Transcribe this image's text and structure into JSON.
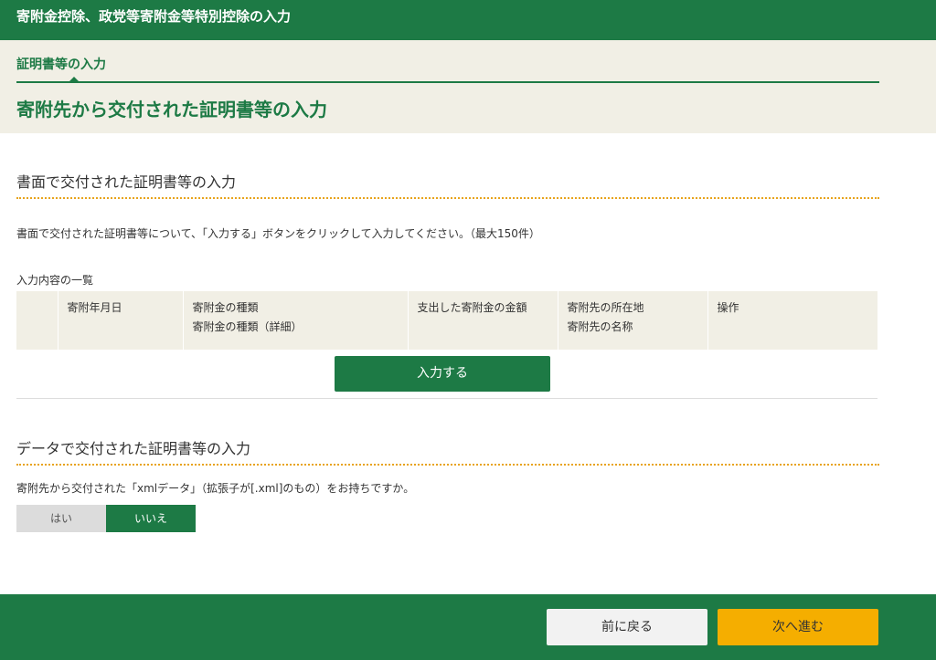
{
  "app": {
    "title": "寄附金控除、政党等寄附金等特別控除の入力"
  },
  "breadcrumb": {
    "step": "証明書等の入力"
  },
  "page": {
    "title": "寄附先から交付された証明書等の入力"
  },
  "paper_section": {
    "title": "書面で交付された証明書等の入力",
    "description": "書面で交付された証明書等について、「入力する」ボタンをクリックして入力してください。（最大150件）",
    "list_label": "入力内容の一覧",
    "table": {
      "columns": [
        {
          "lines": [
            ""
          ]
        },
        {
          "lines": [
            "寄附年月日"
          ]
        },
        {
          "lines": [
            "寄附金の種類",
            "寄附金の種類（詳細）"
          ]
        },
        {
          "lines": [
            "支出した寄附金の金額"
          ]
        },
        {
          "lines": [
            "寄附先の所在地",
            "寄附先の名称"
          ]
        },
        {
          "lines": [
            "操作"
          ]
        }
      ]
    },
    "input_button": "入力する"
  },
  "data_section": {
    "title": "データで交付された証明書等の入力",
    "question": "寄附先から交付された「xmlデータ」（拡張子が[.xml]のもの）をお持ちですか。",
    "options": {
      "yes": "はい",
      "no": "いいえ"
    },
    "selected": "いいえ"
  },
  "footer": {
    "back": "前に戻る",
    "next": "次へ進む"
  },
  "colors": {
    "brand_green": "#1d7a45",
    "accent_orange": "#f5ae00",
    "header_bg": "#f1efe5",
    "dotted_line": "#e8a31b"
  }
}
